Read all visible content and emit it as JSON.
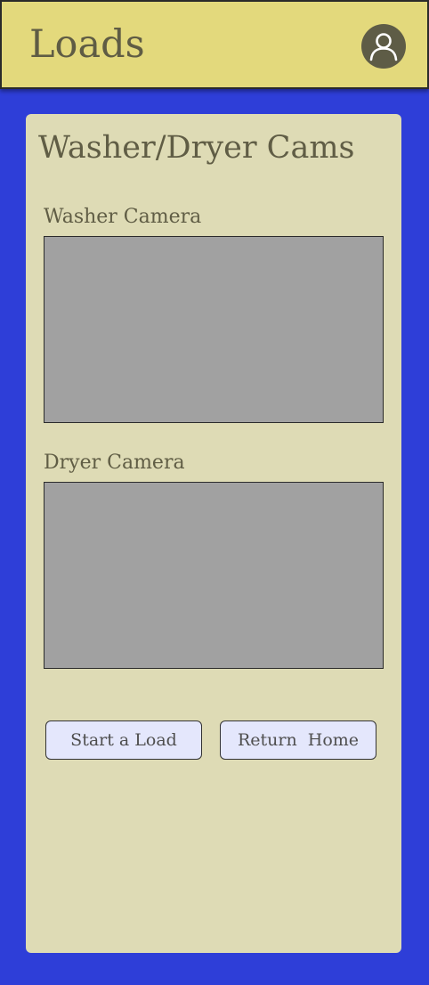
{
  "header": {
    "title": "Loads",
    "profile_icon": "user-profile-icon"
  },
  "colors": {
    "page_background": "#2e3ed8",
    "header_background": "#e3d97c",
    "card_background": "#dedbb5",
    "text": "#605d45",
    "camera_placeholder": "#a1a1a1",
    "button_background": "#e4e7fc"
  },
  "card": {
    "title": "Washer/Dryer Cams",
    "washer": {
      "label": "Washer Camera"
    },
    "dryer": {
      "label": "Dryer Camera"
    }
  },
  "actions": {
    "start_label": "Start a Load",
    "home_label": "Return  Home"
  }
}
